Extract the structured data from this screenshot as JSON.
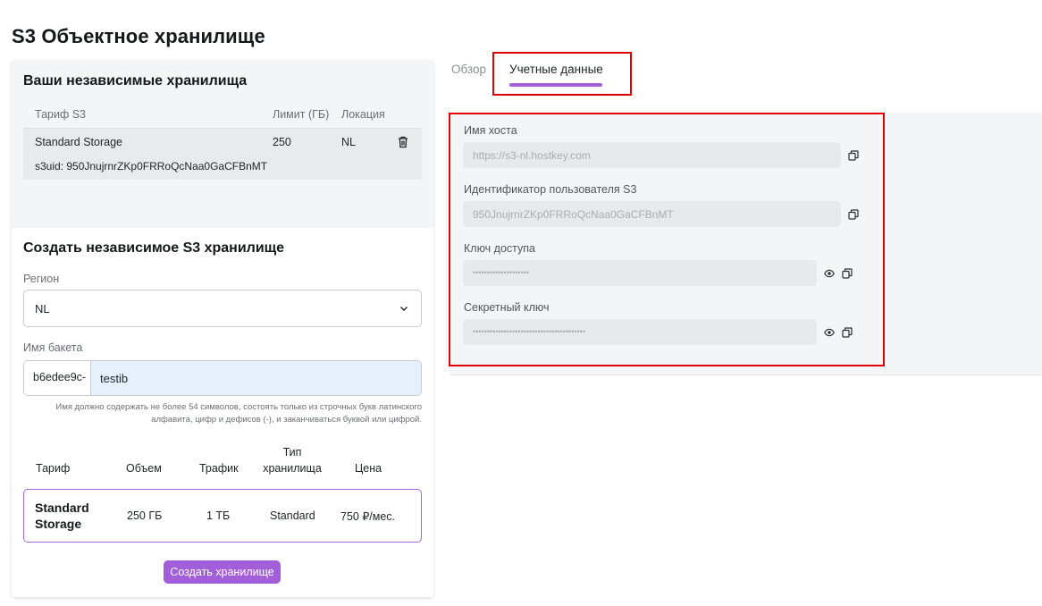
{
  "page": {
    "title": "S3 Объектное хранилище"
  },
  "storages": {
    "title": "Ваши независимые хранилища",
    "columns": [
      "Тариф S3",
      "Лимит (ГБ)",
      "Локация"
    ],
    "rows": [
      {
        "plan": "Standard Storage",
        "limit": "250",
        "location": "NL",
        "uid": "s3uid: 950JnujrnrZKp0FRRoQcNaa0GaCFBnMT"
      }
    ]
  },
  "create": {
    "title": "Создать независимое S3 хранилище",
    "region_label": "Регион",
    "region_value": "NL",
    "bucket_label": "Имя бакета",
    "bucket_prefix": "b6edee9c-",
    "bucket_value": "testib",
    "hint_line1": "Имя должно содержать не более 54 символов, состоять только из строчных букв латинского",
    "hint_line2": "алфавита, цифр и дефисов (-), и заканчиваться буквой или цифрой.",
    "plan_columns": {
      "plan": "Тариф",
      "volume": "Объем",
      "traffic": "Трафик",
      "type_line1": "Тип",
      "type_line2": "хранилища",
      "price": "Цена"
    },
    "plan": {
      "name_line1": "Standard",
      "name_line2": "Storage",
      "volume": "250 ГБ",
      "traffic": "1 ТБ",
      "type": "Standard",
      "price": "750 ₽/мес."
    },
    "submit_label": "Создать хранилище"
  },
  "tabs": [
    {
      "label": "Обзор",
      "active": false
    },
    {
      "label": "Учетные данные",
      "active": true
    }
  ],
  "credentials": {
    "host_label": "Имя хоста",
    "host_value": "https://s3-nl.hostkey.com",
    "user_label": "Идентификатор пользователя S3",
    "user_value": "950JnujrnrZKp0FRRoQcNaa0GaCFBnMT",
    "access_label": "Ключ доступа",
    "access_value": "••••••••••••••••••••",
    "secret_label": "Секретный ключ",
    "secret_value": "••••••••••••••••••••••••••••••••••••••••"
  },
  "icons": [
    "trash-icon",
    "chevron-down-icon",
    "copy-icon",
    "eye-icon"
  ],
  "colors": {
    "accent": "#a35ed9",
    "highlight": "#e00000",
    "input_active": "#e6f0fc"
  }
}
